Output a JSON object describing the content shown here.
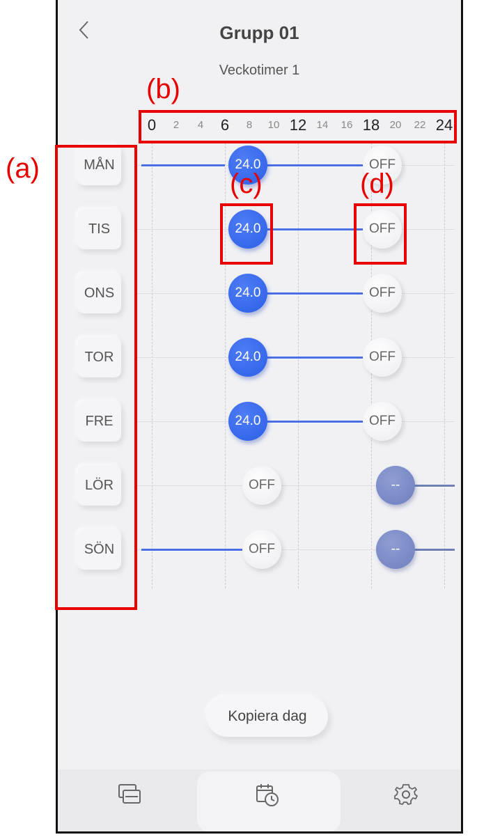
{
  "header": {
    "title": "Grupp 01",
    "subtitle": "Veckotimer 1"
  },
  "time_axis": {
    "ticks": [
      {
        "label": "0",
        "major": true
      },
      {
        "label": "2",
        "major": false
      },
      {
        "label": "4",
        "major": false
      },
      {
        "label": "6",
        "major": true
      },
      {
        "label": "8",
        "major": false
      },
      {
        "label": "10",
        "major": false
      },
      {
        "label": "12",
        "major": true
      },
      {
        "label": "14",
        "major": false
      },
      {
        "label": "16",
        "major": false
      },
      {
        "label": "18",
        "major": true
      },
      {
        "label": "20",
        "major": false
      },
      {
        "label": "22",
        "major": false
      },
      {
        "label": "24",
        "major": true
      }
    ]
  },
  "days": [
    {
      "label": "MÅN",
      "left_knob": "24.0",
      "right_knob": "OFF"
    },
    {
      "label": "TIS",
      "left_knob": "24.0",
      "right_knob": "OFF"
    },
    {
      "label": "ONS",
      "left_knob": "24.0",
      "right_knob": "OFF"
    },
    {
      "label": "TOR",
      "left_knob": "24.0",
      "right_knob": "OFF"
    },
    {
      "label": "FRE",
      "left_knob": "24.0",
      "right_knob": "OFF"
    },
    {
      "label": "LÖR",
      "left_knob": "OFF",
      "right_knob": "--"
    },
    {
      "label": "SÖN",
      "left_knob": "OFF",
      "right_knob": "--"
    }
  ],
  "copy_button": {
    "label": "Kopiera dag"
  },
  "bottom_nav": {
    "items": [
      {
        "icon": "groups-icon"
      },
      {
        "icon": "schedule-timer-icon"
      },
      {
        "icon": "gear-icon"
      }
    ]
  },
  "annotations": {
    "a": "(a)",
    "b": "(b)",
    "c": "(c)",
    "d": "(d)"
  },
  "colors": {
    "accent": "#2a5ee6",
    "annotation": "#e60000",
    "background": "#f1f1f4"
  }
}
